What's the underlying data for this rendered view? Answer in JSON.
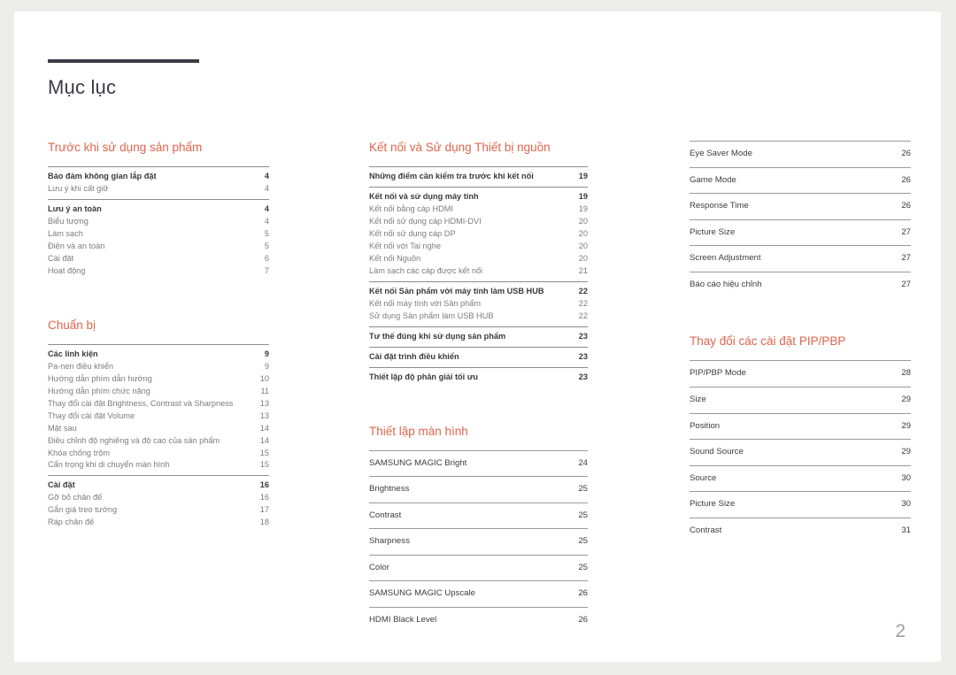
{
  "document": {
    "title": "Mục lục",
    "page_number": "2",
    "accent_color": "#e0644c",
    "rule_color": "#3d3a45"
  },
  "columns": [
    {
      "id": "column-1",
      "sections": [
        {
          "heading": "Trước khi sử dụng sản phẩm",
          "groups": [
            {
              "entries": [
                {
                  "label": "Bảo đảm không gian lắp đặt",
                  "page": "4",
                  "lead": true
                },
                {
                  "label": "Lưu ý khi cất giữ",
                  "page": "4",
                  "lead": false
                }
              ]
            },
            {
              "entries": [
                {
                  "label": "Lưu ý an toàn",
                  "page": "4",
                  "lead": true
                },
                {
                  "label": "Biểu tượng",
                  "page": "4",
                  "lead": false
                },
                {
                  "label": "Làm sạch",
                  "page": "5",
                  "lead": false
                },
                {
                  "label": "Điện và an toàn",
                  "page": "5",
                  "lead": false
                },
                {
                  "label": "Cài đặt",
                  "page": "6",
                  "lead": false
                },
                {
                  "label": "Hoạt động",
                  "page": "7",
                  "lead": false
                }
              ]
            }
          ]
        },
        {
          "heading": "Chuẩn bị",
          "groups": [
            {
              "entries": [
                {
                  "label": "Các linh kiện",
                  "page": "9",
                  "lead": true
                },
                {
                  "label": "Pa-nen điều khiển",
                  "page": "9",
                  "lead": false
                },
                {
                  "label": "Hướng dẫn phím dẫn hướng",
                  "page": "10",
                  "lead": false
                },
                {
                  "label": "Hướng dẫn phím chức năng",
                  "page": "11",
                  "lead": false
                },
                {
                  "label": "Thay đổi cài đặt Brightness, Contrast và Sharpness",
                  "page": "13",
                  "lead": false,
                  "tight": true
                },
                {
                  "label": "Thay đổi cài đặt Volume",
                  "page": "13",
                  "lead": false
                },
                {
                  "label": "Mặt sau",
                  "page": "14",
                  "lead": false
                },
                {
                  "label": "Điều chỉnh độ nghiêng và độ cao của sản phẩm",
                  "page": "14",
                  "lead": false
                },
                {
                  "label": "Khóa chống trộm",
                  "page": "15",
                  "lead": false
                },
                {
                  "label": "Cẩn trọng khi di chuyển màn hình",
                  "page": "15",
                  "lead": false
                }
              ]
            },
            {
              "entries": [
                {
                  "label": "Cài đặt",
                  "page": "16",
                  "lead": true
                },
                {
                  "label": "Gỡ bỏ chân đế",
                  "page": "16",
                  "lead": false
                },
                {
                  "label": "Gắn giá treo tường",
                  "page": "17",
                  "lead": false
                },
                {
                  "label": "Ráp chân đế",
                  "page": "18",
                  "lead": false
                }
              ]
            }
          ]
        }
      ]
    },
    {
      "id": "column-2",
      "sections": [
        {
          "heading": "Kết nối và Sử dụng Thiết bị nguồn",
          "groups": [
            {
              "entries": [
                {
                  "label": "Những điểm cần kiểm tra trước khi kết nối",
                  "page": "19",
                  "lead": true
                }
              ]
            },
            {
              "entries": [
                {
                  "label": "Kết nối và sử dụng máy tính",
                  "page": "19",
                  "lead": true
                },
                {
                  "label": "Kết nối bằng cáp HDMI",
                  "page": "19",
                  "lead": false
                },
                {
                  "label": "Kết nối sử dụng cáp HDMI-DVI",
                  "page": "20",
                  "lead": false
                },
                {
                  "label": "Kết nối sử dụng cáp DP",
                  "page": "20",
                  "lead": false
                },
                {
                  "label": "Kết nối với Tai nghe",
                  "page": "20",
                  "lead": false
                },
                {
                  "label": "Kết nối Nguồn",
                  "page": "20",
                  "lead": false
                },
                {
                  "label": "Làm sạch các cáp được kết nối",
                  "page": "21",
                  "lead": false
                }
              ]
            },
            {
              "entries": [
                {
                  "label": "Kết nối Sản phẩm với máy tính làm USB HUB",
                  "page": "22",
                  "lead": true
                },
                {
                  "label": "Kết nối máy tính với Sản phẩm",
                  "page": "22",
                  "lead": false
                },
                {
                  "label": "Sử dụng Sản phẩm làm USB HUB",
                  "page": "22",
                  "lead": false
                }
              ]
            },
            {
              "entries": [
                {
                  "label": "Tư thế đúng khi sử dụng sản phẩm",
                  "page": "23",
                  "lead": true
                }
              ]
            },
            {
              "entries": [
                {
                  "label": "Cài đặt trình điều khiển",
                  "page": "23",
                  "lead": true
                }
              ]
            },
            {
              "entries": [
                {
                  "label": "Thiết lập độ phân giải tối ưu",
                  "page": "23",
                  "lead": true
                }
              ]
            }
          ]
        },
        {
          "heading": "Thiết lập màn hình",
          "boxed": true,
          "groups": [
            {
              "entries": [
                {
                  "label": "SAMSUNG MAGIC Bright",
                  "page": "24"
                }
              ]
            },
            {
              "entries": [
                {
                  "label": "Brightness",
                  "page": "25"
                }
              ]
            },
            {
              "entries": [
                {
                  "label": "Contrast",
                  "page": "25"
                }
              ]
            },
            {
              "entries": [
                {
                  "label": "Sharpness",
                  "page": "25"
                }
              ]
            },
            {
              "entries": [
                {
                  "label": "Color",
                  "page": "25"
                }
              ]
            },
            {
              "entries": [
                {
                  "label": "SAMSUNG MAGIC Upscale",
                  "page": "26"
                }
              ]
            },
            {
              "entries": [
                {
                  "label": "HDMI Black Level",
                  "page": "26"
                }
              ]
            }
          ]
        }
      ]
    },
    {
      "id": "column-3",
      "sections": [
        {
          "heading": "",
          "boxed": true,
          "groups": [
            {
              "entries": [
                {
                  "label": "Eye Saver Mode",
                  "page": "26"
                }
              ]
            },
            {
              "entries": [
                {
                  "label": "Game Mode",
                  "page": "26"
                }
              ]
            },
            {
              "entries": [
                {
                  "label": "Response Time",
                  "page": "26"
                }
              ]
            },
            {
              "entries": [
                {
                  "label": "Picture Size",
                  "page": "27"
                }
              ]
            },
            {
              "entries": [
                {
                  "label": "Screen Adjustment",
                  "page": "27"
                }
              ]
            },
            {
              "entries": [
                {
                  "label": "Báo cáo hiệu chỉnh",
                  "page": "27"
                }
              ]
            }
          ]
        },
        {
          "heading": "Thay đổi các cài đặt PIP/PBP",
          "boxed": true,
          "groups": [
            {
              "entries": [
                {
                  "label": "PIP/PBP Mode",
                  "page": "28"
                }
              ]
            },
            {
              "entries": [
                {
                  "label": "Size",
                  "page": "29"
                }
              ]
            },
            {
              "entries": [
                {
                  "label": "Position",
                  "page": "29"
                }
              ]
            },
            {
              "entries": [
                {
                  "label": "Sound Source",
                  "page": "29"
                }
              ]
            },
            {
              "entries": [
                {
                  "label": "Source",
                  "page": "30"
                }
              ]
            },
            {
              "entries": [
                {
                  "label": "Picture Size",
                  "page": "30"
                }
              ]
            },
            {
              "entries": [
                {
                  "label": "Contrast",
                  "page": "31"
                }
              ]
            }
          ]
        }
      ]
    }
  ]
}
